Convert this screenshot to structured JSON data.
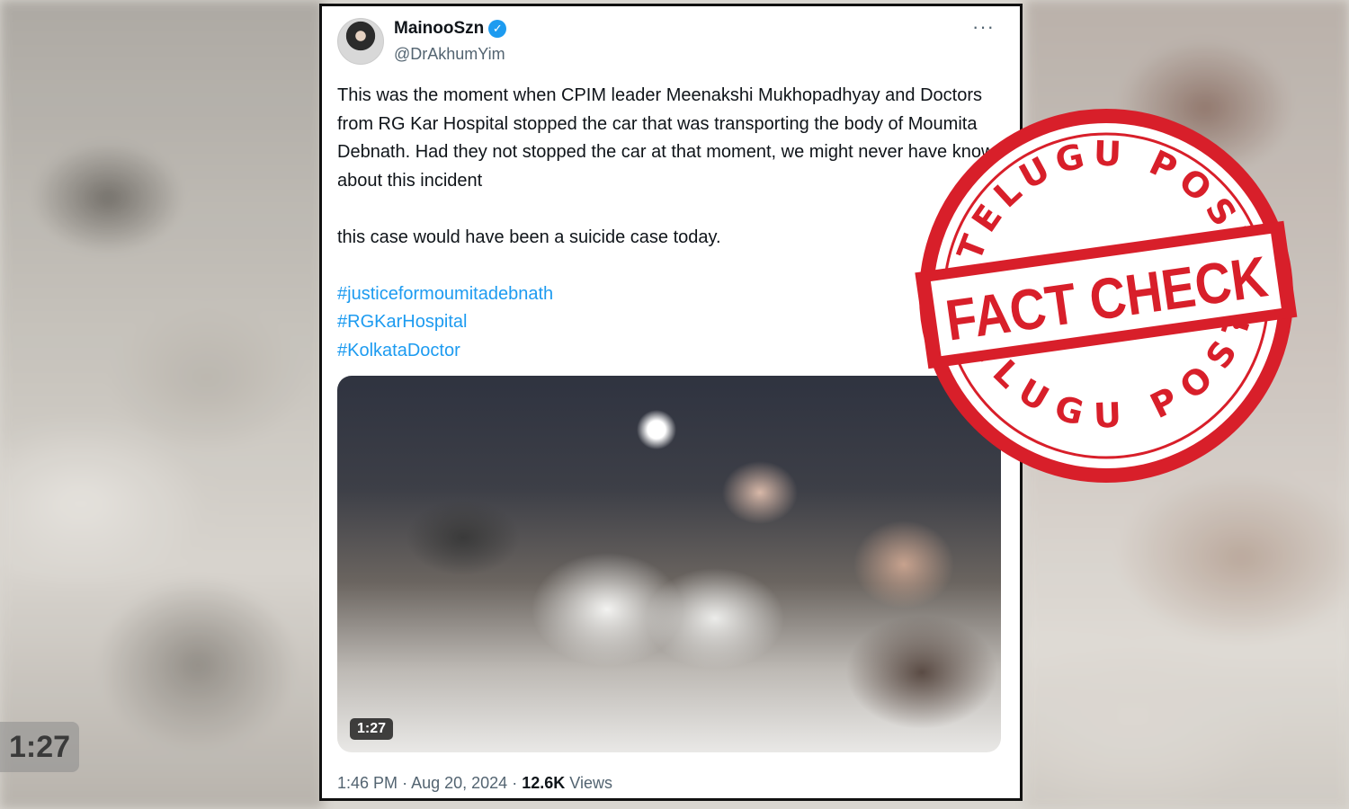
{
  "background": {
    "timestamp": "1:27"
  },
  "tweet": {
    "display_name": "MainooSzn",
    "handle": "@DrAkhumYim",
    "more_icon": "···",
    "text_paragraph_1": "This was the moment when CPIM leader Meenakshi Mukhopadhyay and Doctors from RG Kar Hospital stopped the car that was transporting the body of Moumita Debnath. Had they not stopped the car at that moment, we might never have known about this incident",
    "text_paragraph_2": "this case would have been a suicide case today.",
    "hashtags": [
      "#justiceformoumitadebnath",
      "#RGKarHospital",
      "#KolkataDoctor"
    ],
    "video_duration": "1:27",
    "time": "1:46 PM",
    "separator": "·",
    "date": "Aug 20, 2024",
    "views_count": "12.6K",
    "views_label": "Views",
    "verified_color": "#1d9bf0"
  },
  "stamp": {
    "top_arc": "TELUGU POST",
    "main_text": "FACT CHECK",
    "bottom_arc": "TELUGU POST",
    "color": "#d81f2a"
  }
}
